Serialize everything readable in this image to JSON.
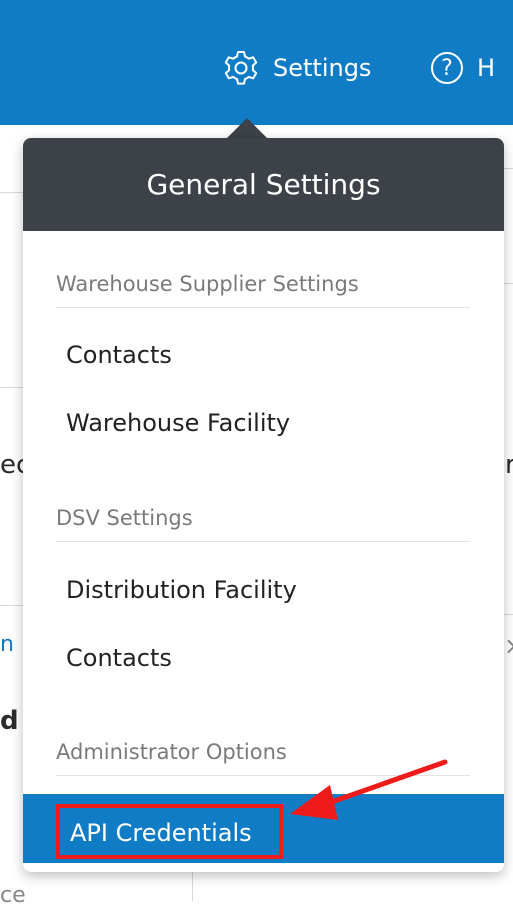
{
  "topbar": {
    "settings_label": "Settings",
    "help_symbol": "?",
    "help_label": "H"
  },
  "background_fragments": {
    "left_mid": "ec",
    "right_mid": "r",
    "left_link": "n",
    "left_bold": "d",
    "bottom_left": "ce",
    "right_close": "×"
  },
  "dropdown": {
    "title": "General Settings",
    "sections": [
      {
        "heading": "Warehouse Supplier Settings",
        "items": [
          "Contacts",
          "Warehouse Facility"
        ]
      },
      {
        "heading": "DSV Settings",
        "items": [
          "Distribution Facility",
          "Contacts"
        ]
      },
      {
        "heading": "Administrator Options",
        "items": [
          "API Credentials"
        ]
      }
    ]
  },
  "colors": {
    "topbar": "#0f7cc5",
    "dropdown_header": "#3c4247",
    "active_item": "#0f7cc5",
    "annotation": "#ef1b1b"
  },
  "icons": [
    "gear-icon",
    "help-circle-icon",
    "annotation-arrow"
  ]
}
